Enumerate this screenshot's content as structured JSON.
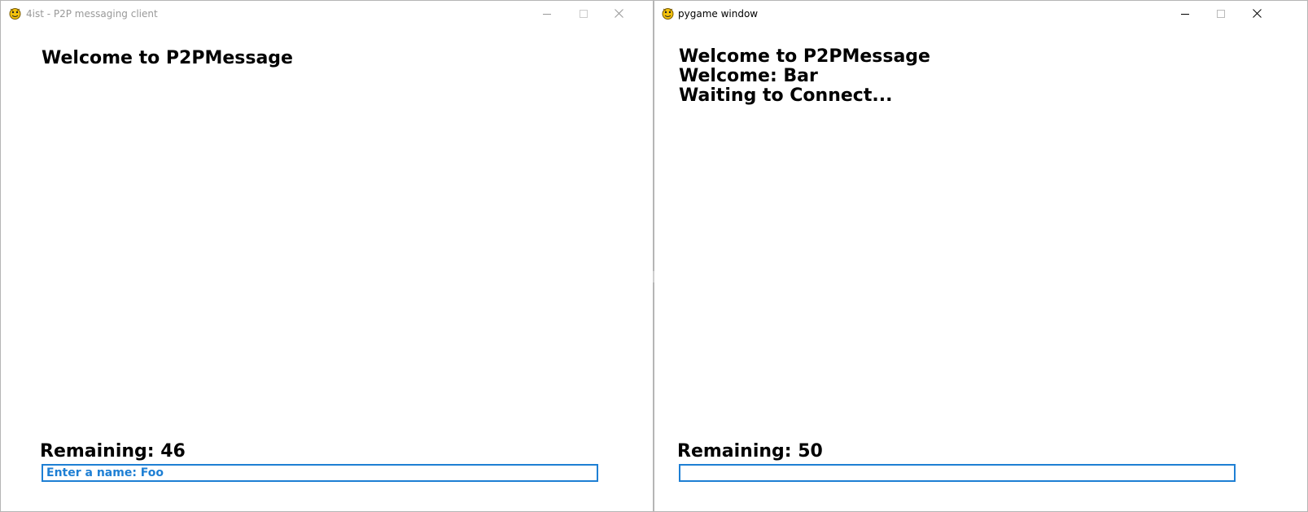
{
  "colors": {
    "input_border": "#1e7fd4",
    "input_text": "#1e7fd4",
    "inactive_title": "#999999"
  },
  "left_window": {
    "title": "4ist - P2P messaging client",
    "icon": "pygame-snake-icon",
    "heading": "Welcome to P2PMessage",
    "remaining": "Remaining: 46",
    "input_text": "Enter a name: Foo",
    "controls": [
      "minimize-icon",
      "maximize-icon",
      "close-icon"
    ]
  },
  "right_window": {
    "title": "pygame window",
    "icon": "pygame-snake-icon",
    "lines": [
      "Welcome to P2PMessage",
      "Welcome: Bar",
      "Waiting to Connect..."
    ],
    "remaining": "Remaining: 50",
    "input_text": "",
    "controls": [
      "minimize-icon",
      "maximize-icon",
      "close-icon"
    ]
  }
}
